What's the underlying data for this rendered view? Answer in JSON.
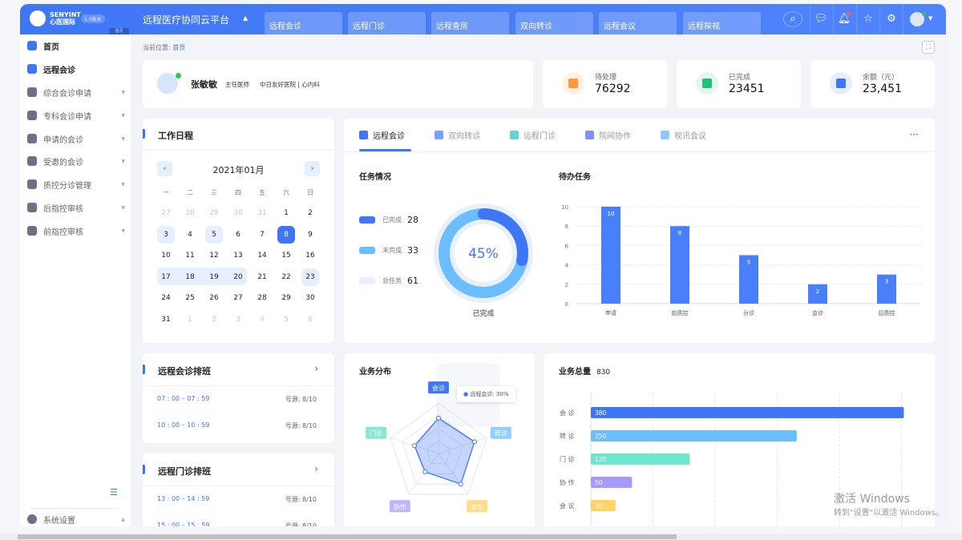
{
  "header": {
    "brand_en": "SENYINT",
    "brand_cn": "心医国际",
    "version": "1.0版本",
    "home_tag": "首页",
    "title": "远程医疗协同云平台",
    "nav_tabs": [
      "远程会诊",
      "远程门诊",
      "远程查房",
      "双向转诊",
      "远程会议",
      "远程探视"
    ],
    "icons": [
      "search-icon",
      "chat-icon",
      "bell-icon",
      "star-icon",
      "gear-icon",
      "avatar"
    ],
    "accent": "#3f76f5"
  },
  "sidebar": {
    "items": [
      {
        "label": "首页",
        "active": true
      },
      {
        "label": "远程会诊",
        "active": true
      },
      {
        "label": "综合会诊申请"
      },
      {
        "label": "专科会诊申请"
      },
      {
        "label": "申请的会诊"
      },
      {
        "label": "受邀的会诊"
      },
      {
        "label": "质控分诊管理"
      },
      {
        "label": "后指控审核"
      },
      {
        "label": "前指控审核"
      }
    ],
    "settings": "系统设置"
  },
  "breadcrumb": {
    "prefix": "当前位置:",
    "current": "首页"
  },
  "profile": {
    "name": "张敏敏",
    "title": "主任医师",
    "org": "中日友好医院 | 心内科"
  },
  "stats": [
    {
      "label": "待处理",
      "value": "76292",
      "color": "#ff9a3c"
    },
    {
      "label": "已完成",
      "value": "23451",
      "color": "#22c07a"
    },
    {
      "label": "余额（元）",
      "value": "23,451",
      "color": "#3f76f5"
    }
  ],
  "calendar": {
    "title": "工作日程",
    "month": "2021年01月",
    "weekdays": [
      "一",
      "二",
      "三",
      "四",
      "五",
      "六",
      "日"
    ],
    "days": [
      [
        "27",
        "o"
      ],
      [
        "28",
        "o"
      ],
      [
        "29",
        "o"
      ],
      [
        "30",
        "o"
      ],
      [
        "31",
        "o"
      ],
      [
        "1",
        ""
      ],
      [
        "2",
        ""
      ],
      [
        "3",
        "h"
      ],
      [
        "4",
        ""
      ],
      [
        "5",
        "h"
      ],
      [
        "6",
        ""
      ],
      [
        "7",
        ""
      ],
      [
        "8",
        "s"
      ],
      [
        "9",
        ""
      ],
      [
        "10",
        ""
      ],
      [
        "11",
        ""
      ],
      [
        "12",
        ""
      ],
      [
        "13",
        ""
      ],
      [
        "14",
        ""
      ],
      [
        "15",
        ""
      ],
      [
        "16",
        ""
      ],
      [
        "17",
        "r"
      ],
      [
        "18",
        "r"
      ],
      [
        "19",
        "r"
      ],
      [
        "20",
        "r"
      ],
      [
        "21",
        ""
      ],
      [
        "22",
        ""
      ],
      [
        "23",
        "h"
      ],
      [
        "24",
        ""
      ],
      [
        "25",
        ""
      ],
      [
        "26",
        ""
      ],
      [
        "27",
        ""
      ],
      [
        "28",
        ""
      ],
      [
        "29",
        ""
      ],
      [
        "30",
        ""
      ],
      [
        "31",
        ""
      ],
      [
        "1",
        "o"
      ],
      [
        "2",
        "o"
      ],
      [
        "3",
        "o"
      ],
      [
        "4",
        "o"
      ],
      [
        "5",
        "o"
      ],
      [
        "6",
        "o"
      ]
    ]
  },
  "schedules": [
    {
      "title": "远程会诊排班",
      "rows": [
        {
          "time": "07 : 00 – 07 : 59",
          "src": "号源: 8/10"
        },
        {
          "time": "10 : 00 – 10 : 59",
          "src": "号源: 8/10"
        }
      ]
    },
    {
      "title": "远程门诊排班",
      "rows": [
        {
          "time": "13 : 00 – 14 : 59",
          "src": "号源: 8/10"
        },
        {
          "time": "15 : 00 – 15 : 59",
          "src": "号源: 8/10"
        }
      ]
    }
  ],
  "tabs": [
    {
      "label": "远程会诊",
      "active": true
    },
    {
      "label": "双向转诊"
    },
    {
      "label": "远程门诊"
    },
    {
      "label": "院间协作"
    },
    {
      "label": "视讯会议"
    }
  ],
  "more": "···",
  "chart_data": [
    {
      "type": "pie",
      "title": "任务情况",
      "legend": [
        {
          "name": "已完成",
          "value": 28,
          "color": "#3f76f5"
        },
        {
          "name": "未完成",
          "value": 33,
          "color": "#6cbdfb"
        },
        {
          "name": "总任务",
          "value": 61,
          "color": "#e8f0fd"
        }
      ],
      "center_label": "45%",
      "percent": 45,
      "caption": "已完成"
    },
    {
      "type": "bar",
      "title": "待办任务",
      "categories": [
        "申请",
        "前质控",
        "分诊",
        "会诊",
        "后质控"
      ],
      "values": [
        10,
        8,
        5,
        2,
        3
      ],
      "ylim": [
        0,
        10
      ],
      "yticks": [
        0,
        2,
        4,
        6,
        8,
        10
      ],
      "grid": true,
      "color": "#4a7ffa"
    },
    {
      "type": "radar",
      "title": "业务分布",
      "indicators": [
        "会诊",
        "转诊",
        "会议",
        "协作",
        "门诊"
      ],
      "values": [
        70,
        75,
        75,
        45,
        50
      ],
      "max": 100,
      "tooltip": "远程会诊: 30%",
      "colors": [
        "#3f76f5",
        "#6cbdfb",
        "#ffce5c",
        "#a59bfb",
        "#5fe0c0"
      ]
    },
    {
      "type": "bar",
      "orientation": "horizontal",
      "title": "业务总量",
      "total": "830",
      "categories": [
        "会 诊",
        "转 诊",
        "门 诊",
        "协 作",
        "会 议"
      ],
      "values": [
        380,
        250,
        120,
        50,
        30
      ],
      "xlim": [
        0,
        400
      ],
      "colors": [
        "#3f76f5",
        "#6cbdfb",
        "#6ee6cc",
        "#a59bfb",
        "#ffd466"
      ],
      "grid": true
    }
  ],
  "watermark": {
    "line1": "激活 Windows",
    "line2": "转到\"设置\"以激活 Windows。"
  }
}
